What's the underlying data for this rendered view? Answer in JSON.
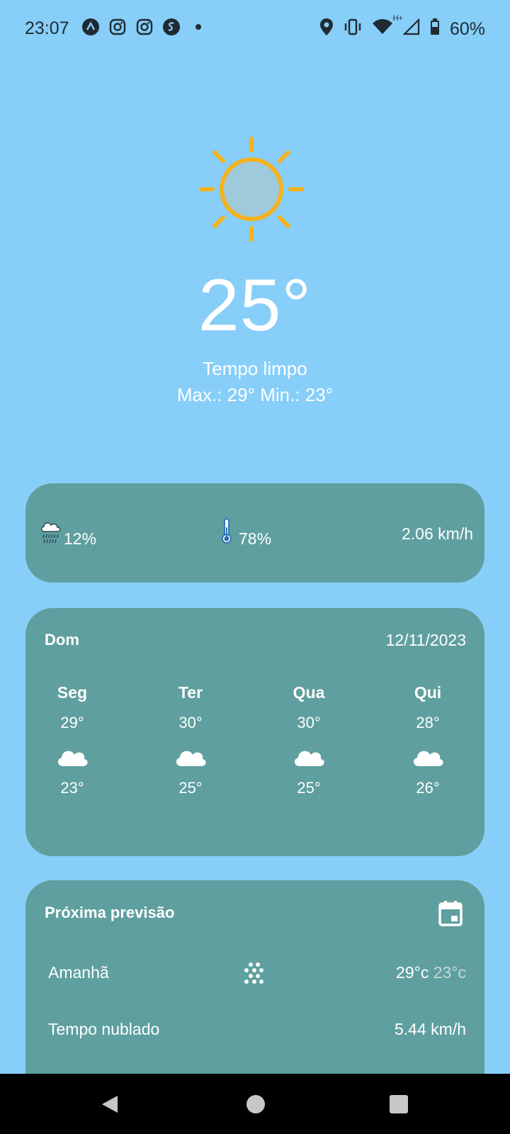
{
  "status_bar": {
    "time": "23:07",
    "battery": "60%",
    "network": "H+",
    "left_icons": [
      "app-icon",
      "instagram-icon",
      "instagram-icon",
      "shazam-icon",
      "dot-icon"
    ],
    "right_icons": [
      "location-icon",
      "vibrate-icon",
      "wifi-icon",
      "signal-icon",
      "battery-icon"
    ]
  },
  "current": {
    "icon": "sun-icon",
    "temperature": "25°",
    "condition": "Tempo limpo",
    "maxmin": "Max.: 29° Min.: 23°"
  },
  "stats": {
    "rain": "12%",
    "humidity": "78%",
    "wind": "2.06 km/h",
    "rain_icon": "rain-cloud-icon",
    "humidity_icon": "thermometer-icon"
  },
  "week": {
    "today": "Dom",
    "date": "12/11/2023",
    "days": [
      {
        "name": "Seg",
        "max": "29°",
        "min": "23°",
        "icon": "cloud-icon"
      },
      {
        "name": "Ter",
        "max": "30°",
        "min": "25°",
        "icon": "cloud-icon"
      },
      {
        "name": "Qua",
        "max": "30°",
        "min": "25°",
        "icon": "cloud-icon"
      },
      {
        "name": "Qui",
        "max": "28°",
        "min": "26°",
        "icon": "cloud-icon"
      }
    ]
  },
  "next": {
    "title": "Próxima previsão",
    "day": "Amanhã",
    "max": "29°c",
    "min": "23°c",
    "condition": "Tempo nublado",
    "wind": "5.44 km/h",
    "icon": "snow-icon"
  },
  "colors": {
    "background": "#87CEF9",
    "card": "#5F9F9F",
    "sun": "#F5B21C"
  }
}
